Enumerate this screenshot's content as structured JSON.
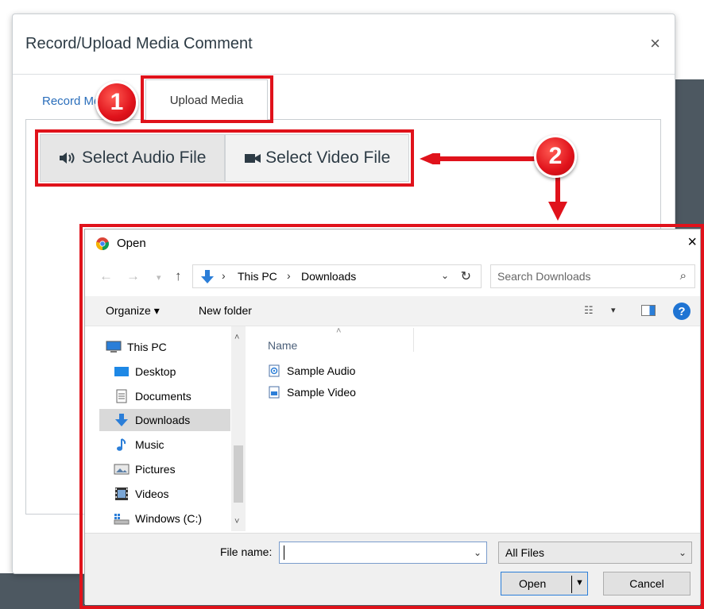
{
  "modal": {
    "title": "Record/Upload Media Comment",
    "close_glyph": "×",
    "tabs": [
      {
        "label": "Record Media"
      },
      {
        "label": "Upload Media"
      }
    ],
    "select_audio_label": "Select Audio File",
    "select_video_label": "Select Video File"
  },
  "annotations": {
    "step1": "1",
    "step2": "2",
    "highlight_color": "#e0121b"
  },
  "open_dialog": {
    "title": "Open",
    "close_glyph": "×",
    "nav": {
      "back": "←",
      "forward": "→",
      "up": "↑"
    },
    "address": {
      "separator": "›",
      "segments": [
        "This PC",
        "Downloads"
      ]
    },
    "search_placeholder": "Search Downloads",
    "toolbar": {
      "organize": "Organize ▾",
      "new_folder": "New folder",
      "help": "?"
    },
    "tree": [
      {
        "label": "This PC",
        "icon": "computer-icon"
      },
      {
        "label": "Desktop",
        "icon": "desktop-icon"
      },
      {
        "label": "Documents",
        "icon": "documents-icon"
      },
      {
        "label": "Downloads",
        "icon": "downloads-icon",
        "selected": true
      },
      {
        "label": "Music",
        "icon": "music-icon"
      },
      {
        "label": "Pictures",
        "icon": "pictures-icon"
      },
      {
        "label": "Videos",
        "icon": "videos-icon"
      },
      {
        "label": "Windows (C:)",
        "icon": "drive-icon"
      }
    ],
    "columns": {
      "name": "Name"
    },
    "files": [
      {
        "label": "Sample Audio",
        "icon": "audio-file-icon"
      },
      {
        "label": "Sample Video",
        "icon": "video-file-icon"
      }
    ],
    "footer": {
      "filename_label": "File name:",
      "filename_value": "",
      "filetype_value": "All Files",
      "open_label": "Open",
      "cancel_label": "Cancel"
    }
  },
  "colors": {
    "link_blue": "#2a6ebb",
    "windows_blue": "#1f74d3"
  }
}
